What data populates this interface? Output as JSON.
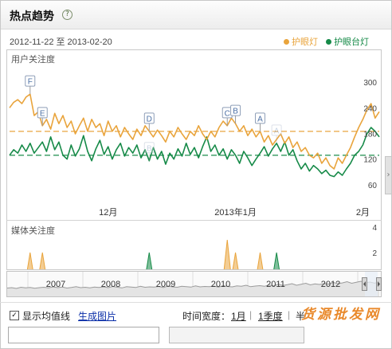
{
  "header": {
    "title": "热点趋势",
    "help_icon": "help-icon"
  },
  "date_range": {
    "start": "2012-11-22",
    "sep": "至",
    "end": "2013-02-20"
  },
  "legend": [
    {
      "name": "护眼灯",
      "color": "#e9a43c"
    },
    {
      "name": "护眼台灯",
      "color": "#168a48"
    }
  ],
  "chart_data": [
    {
      "type": "line",
      "title": "用户关注度",
      "legend_position": "top-right",
      "grid": false,
      "ylim": [
        0,
        360
      ],
      "y_ticks": [
        300,
        240,
        180,
        120,
        60
      ],
      "x_ticks": [
        {
          "label": "12月",
          "date": "2012-12-16"
        },
        {
          "label": "2013年1月",
          "date": "2013-01-16"
        },
        {
          "label": "2月",
          "date": "2013-02-16"
        }
      ],
      "series": [
        {
          "name": "护眼灯",
          "average": 185,
          "values": [
            240,
            253,
            259,
            250,
            265,
            272,
            222,
            231,
            198,
            213,
            190,
            227,
            203,
            222,
            194,
            209,
            179,
            198,
            216,
            185,
            213,
            194,
            203,
            175,
            209,
            185,
            198,
            172,
            194,
            179,
            166,
            190,
            175,
            198,
            185,
            172,
            188,
            175,
            160,
            185,
            172,
            194,
            179,
            166,
            185,
            175,
            198,
            179,
            166,
            185,
            172,
            194,
            209,
            198,
            216,
            203,
            185,
            198,
            175,
            190,
            172,
            185,
            160,
            175,
            153,
            166,
            179,
            157,
            172,
            147,
            160,
            138,
            147,
            129,
            123,
            134,
            110,
            123,
            105,
            97,
            123,
            110,
            129,
            147,
            172,
            194,
            213,
            235,
            250,
            216,
            231
          ]
        },
        {
          "name": "护眼台灯",
          "average": 129,
          "values": [
            129,
            142,
            134,
            153,
            138,
            157,
            134,
            147,
            160,
            138,
            172,
            142,
            160,
            129,
            120,
            153,
            127,
            144,
            175,
            138,
            116,
            144,
            164,
            131,
            149,
            120,
            142,
            157,
            127,
            147,
            134,
            153,
            123,
            142,
            116,
            147,
            120,
            138,
            108,
            134,
            120,
            144,
            127,
            157,
            131,
            147,
            123,
            149,
            172,
            138,
            153,
            129,
            144,
            120,
            142,
            129,
            110,
            138,
            123,
            105,
            120,
            134,
            149,
            127,
            144,
            157,
            138,
            160,
            129,
            142,
            116,
            97,
            110,
            92,
            105,
            97,
            86,
            94,
            82,
            79,
            90,
            82,
            97,
            110,
            129,
            138,
            153,
            179,
            194,
            185,
            172
          ]
        }
      ],
      "events": [
        {
          "series": 0,
          "label": "F",
          "date": "2012-11-27"
        },
        {
          "series": 0,
          "label": "E",
          "date": "2012-11-30"
        },
        {
          "series": 0,
          "label": "D",
          "date": "2012-12-26"
        },
        {
          "series": 0,
          "label": "C",
          "date": "2013-01-14"
        },
        {
          "series": 0,
          "label": "B",
          "date": "2013-01-16"
        },
        {
          "series": 0,
          "label": "A",
          "date": "2013-01-22"
        },
        {
          "series": 1,
          "label": "B",
          "date": "2012-12-26"
        },
        {
          "series": 1,
          "label": "A",
          "date": "2013-01-26"
        }
      ]
    },
    {
      "type": "area",
      "title": "媒体关注度",
      "ylim": [
        0,
        4.5
      ],
      "y_ticks": [
        4,
        2
      ],
      "series": [
        {
          "name": "护眼灯",
          "points": [
            [
              "2012-11-27",
              2
            ],
            [
              "2012-11-30",
              2
            ],
            [
              "2013-01-14",
              3
            ],
            [
              "2013-01-16",
              2
            ],
            [
              "2013-01-22",
              2
            ]
          ]
        },
        {
          "name": "护眼台灯",
          "points": [
            [
              "2012-12-26",
              2
            ],
            [
              "2013-01-26",
              2
            ]
          ]
        }
      ]
    }
  ],
  "timeline": {
    "years": [
      "2007",
      "2008",
      "2009",
      "2010",
      "2011",
      "2012"
    ],
    "overview": [
      38,
      40,
      36,
      42,
      39,
      41,
      37,
      40,
      42,
      39,
      44,
      40,
      43,
      38,
      41,
      45,
      40,
      42,
      39,
      43,
      41,
      44,
      40,
      46,
      42,
      39,
      45,
      43,
      41,
      47,
      42,
      44,
      43,
      46,
      41,
      48,
      44,
      42,
      47,
      45,
      43,
      49,
      44,
      46,
      45,
      48,
      43,
      50,
      46,
      44,
      49,
      47,
      52,
      45,
      48,
      50,
      47,
      53,
      49,
      58,
      51,
      55,
      60,
      52,
      57,
      62,
      54,
      59,
      56,
      61,
      58,
      66,
      60,
      64,
      70,
      62,
      67,
      72,
      65,
      68,
      63,
      69
    ]
  },
  "controls": {
    "show_average_label": "显示均值线",
    "show_average_checked": true,
    "generate_image_label": "生成图片",
    "time_width_label": "时间宽度：",
    "time_width_options": [
      "1月",
      "1季度",
      "半"
    ],
    "separator": "|"
  },
  "watermark": "货源批发网"
}
